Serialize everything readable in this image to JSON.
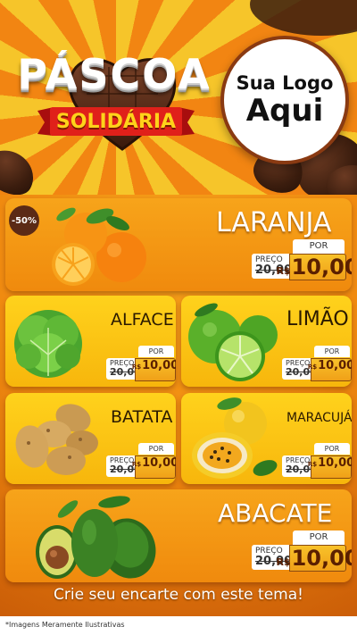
{
  "header": {
    "title": "PÁSCOA",
    "subtitle": "SOLIDÁRIA",
    "logo_line1": "Sua Logo",
    "logo_line2": "Aqui"
  },
  "colors": {
    "orange": "#f08a10",
    "yellow": "#ffd21c",
    "chocolate": "#3b1d0e",
    "price_brown": "#5a1f00"
  },
  "products": [
    {
      "name": "LARANJA",
      "badge": "-50%",
      "preco_label": "PREÇO",
      "old_price": "20,00",
      "por_label": "POR",
      "currency": "R$",
      "new_price": "10,00",
      "icon": "orange-icon"
    },
    {
      "name": "ALFACE",
      "preco_label": "PREÇO",
      "old_price": "20,00",
      "por_label": "POR",
      "currency": "R$",
      "new_price": "10,00",
      "icon": "lettuce-icon"
    },
    {
      "name": "LIMÃO",
      "preco_label": "PREÇO",
      "old_price": "20,00",
      "por_label": "POR",
      "currency": "R$",
      "new_price": "10,00",
      "icon": "lime-icon"
    },
    {
      "name": "BATATA",
      "preco_label": "PREÇO",
      "old_price": "20,00",
      "por_label": "POR",
      "currency": "R$",
      "new_price": "10,00",
      "icon": "potato-icon"
    },
    {
      "name": "MARACUJÁ",
      "preco_label": "PREÇO",
      "old_price": "20,00",
      "por_label": "POR",
      "currency": "R$",
      "new_price": "10,00",
      "icon": "passion-fruit-icon"
    },
    {
      "name": "ABACATE",
      "preco_label": "PREÇO",
      "old_price": "20,00",
      "por_label": "POR",
      "currency": "R$",
      "new_price": "10,00",
      "icon": "avocado-icon"
    }
  ],
  "footer": {
    "cta": "Crie seu encarte com este tema!",
    "disclaimer": "*Imagens Meramente Ilustrativas"
  }
}
